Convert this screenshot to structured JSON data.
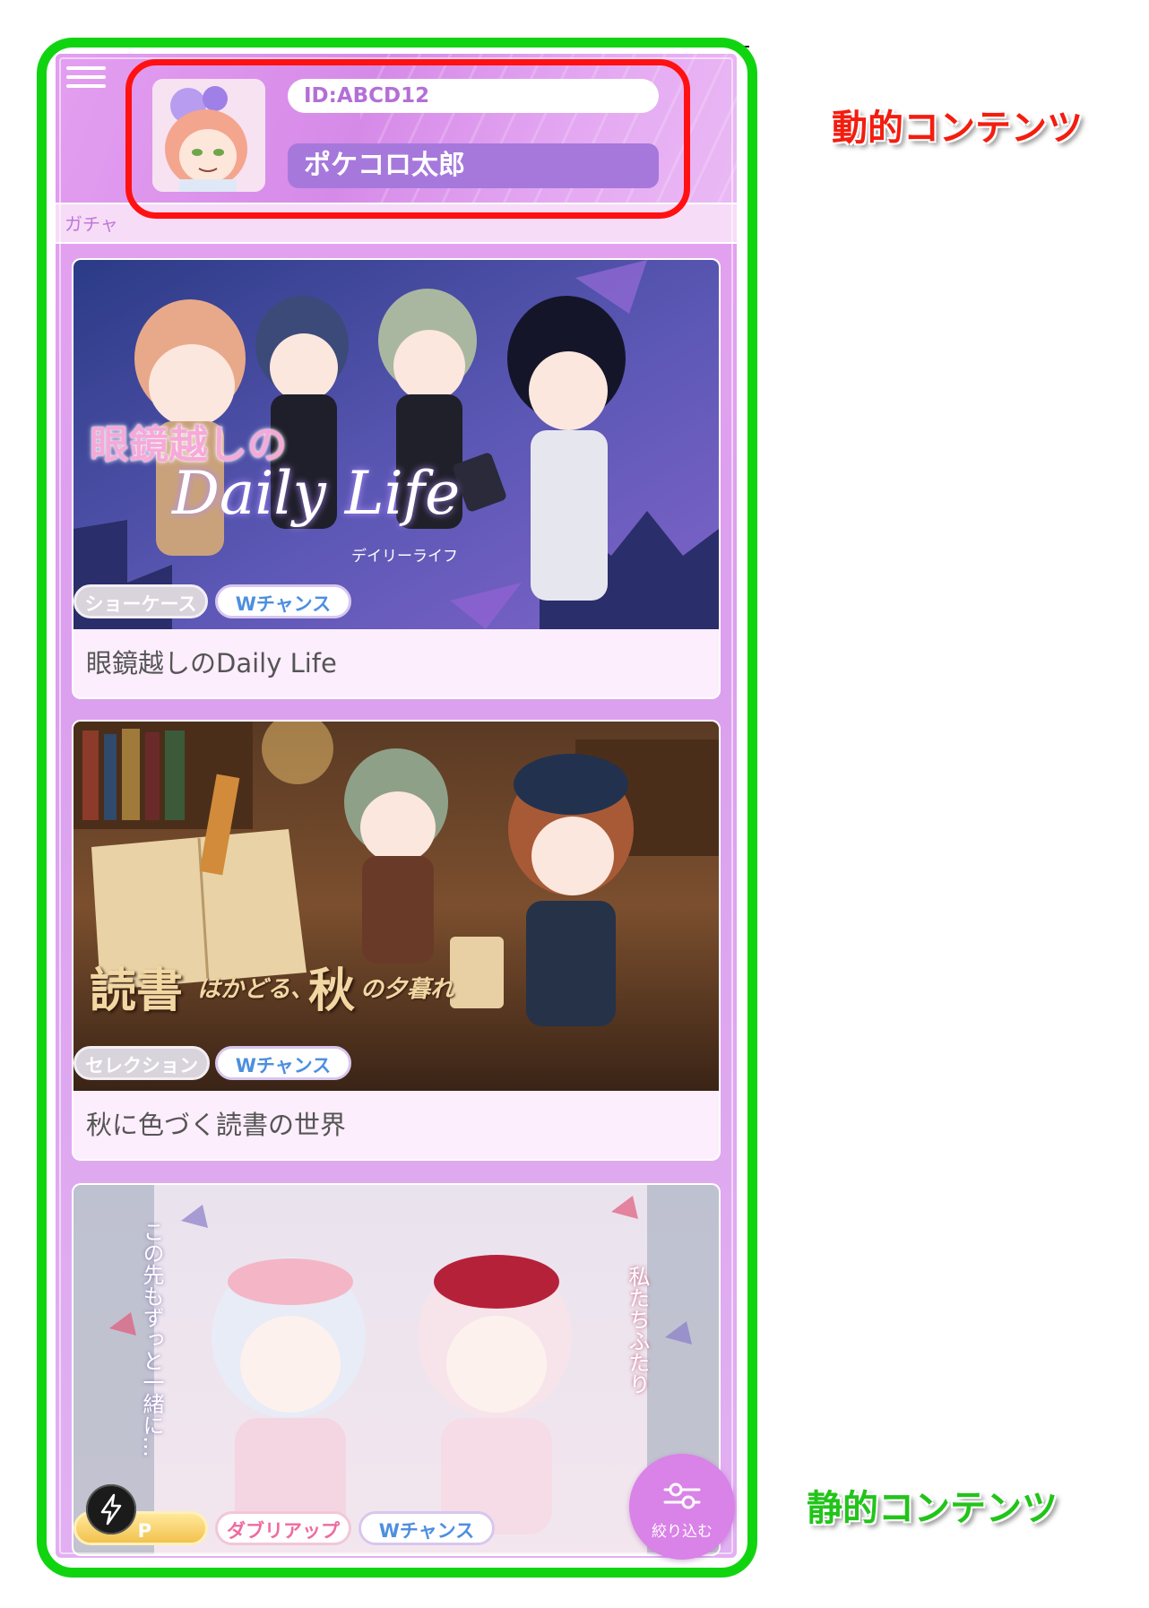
{
  "header": {
    "user_id": "ID:ABCD12",
    "user_name": "ポケコロ太郎"
  },
  "section": {
    "label": "ガチャ"
  },
  "cards": [
    {
      "title": "眼鏡越しのDaily Life",
      "banner_heading": "眼鏡越しの",
      "banner_script": "Daily Life",
      "banner_sub": "デイリーライフ",
      "tags": [
        "ショーケース",
        "Wチャンス"
      ]
    },
    {
      "title": "秋に色づく読書の世界",
      "banner_heading": "読書",
      "banner_mid": "はかどる、",
      "banner_heading2": "秋",
      "banner_tail": "の夕暮れ",
      "tags": [
        "セレクション",
        "Wチャンス"
      ]
    },
    {
      "title": "",
      "banner_vertical_left": "この先もずっと一緒に…",
      "banner_vertical_right": "私たちふたり",
      "tags": [
        "P",
        "ダブリアップ",
        "Wチャンス"
      ]
    }
  ],
  "filter_button": {
    "label": "絞り込む"
  },
  "annotations": {
    "dynamic": "動的コンテンツ",
    "static": "静的コンテンツ"
  },
  "colors": {
    "dynamic_outline": "#ff1111",
    "static_outline": "#11d411",
    "accent": "#a678dc"
  },
  "icons": [
    "hamburger-menu-icon",
    "bolt-icon",
    "filter-sliders-icon"
  ]
}
